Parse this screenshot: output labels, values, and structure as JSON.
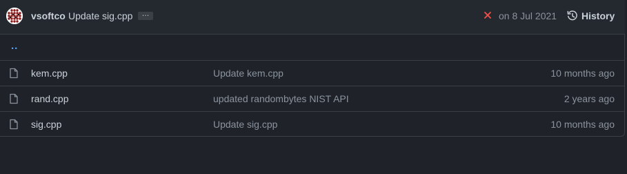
{
  "latest_commit": {
    "author": "vsoftco",
    "message": "Update sig.cpp",
    "expand_label": "…",
    "status": "failed",
    "date": "on 8 Jul 2021",
    "history_label": "History"
  },
  "parent_dir_label": "..",
  "files": [
    {
      "name": "kem.cpp",
      "message": "Update kem.cpp",
      "age": "10 months ago"
    },
    {
      "name": "rand.cpp",
      "message": "updated randombytes NIST API",
      "age": "2 years ago"
    },
    {
      "name": "sig.cpp",
      "message": "Update sig.cpp",
      "age": "10 months ago"
    }
  ],
  "colors": {
    "background": "#1f2229",
    "header": "#24282f",
    "border": "#3a3f47",
    "link": "#58a6ff",
    "muted": "#8b949e",
    "fail": "#f85149"
  }
}
